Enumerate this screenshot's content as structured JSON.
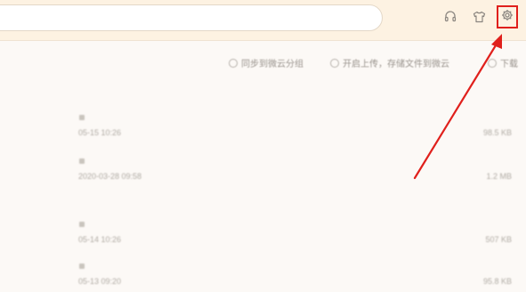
{
  "header": {
    "search": {
      "value": "",
      "placeholder": ""
    },
    "icons": [
      "headset-icon",
      "skin-icon",
      "gear-icon"
    ]
  },
  "toolbar": {
    "actions": [
      {
        "label": "同步到微云分组",
        "icon": "upload-icon"
      },
      {
        "label": "开启上传，存储文件到微云",
        "icon": "sync-icon"
      },
      {
        "label": "下载",
        "icon": "download-icon"
      }
    ]
  },
  "list": {
    "items": [
      {
        "date": "05-15 10:26",
        "size": "98.5 KB"
      },
      {
        "date": "2020-03-28 09:58",
        "size": "1.2 MB"
      },
      {
        "date": "05-14 10:26",
        "size": "507 KB"
      },
      {
        "date": "05-13 09:20",
        "size": "95.8 KB"
      }
    ]
  },
  "annotation": {
    "color": "#e0201c",
    "target": "settings-button"
  },
  "colors": {
    "header_bg": "#fdf2e2",
    "page_bg": "#fcf9f6",
    "accent_red": "#e0201c"
  }
}
